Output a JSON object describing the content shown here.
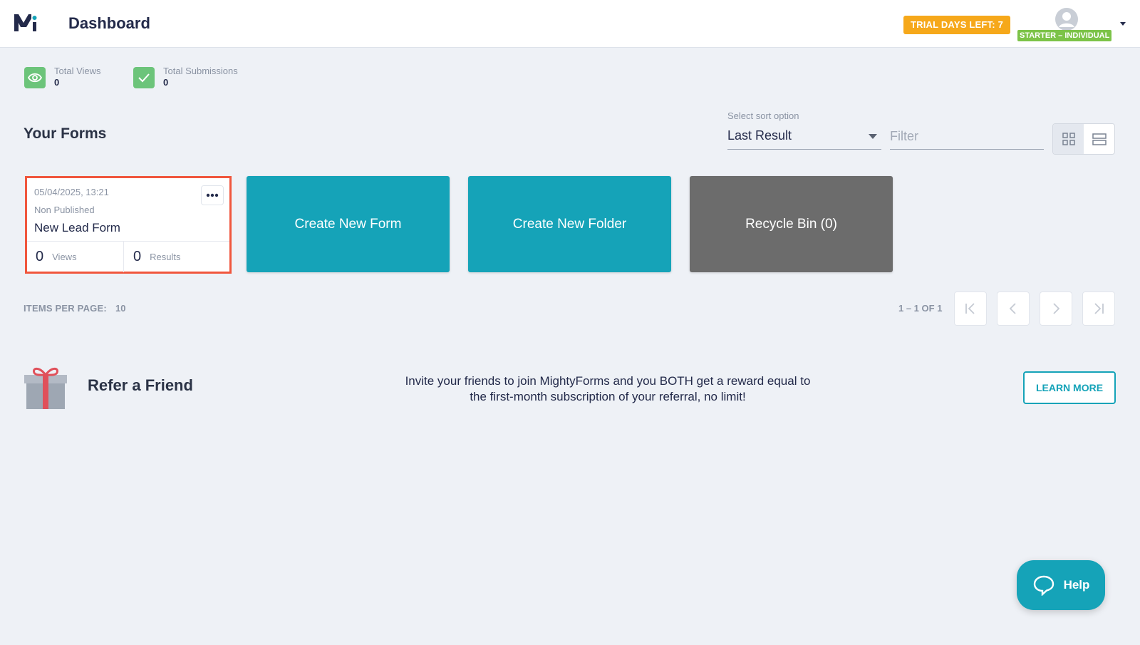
{
  "header": {
    "title": "Dashboard",
    "trial_badge": "TRIAL DAYS LEFT: 7",
    "plan_badge": "STARTER – INDIVIDUAL"
  },
  "stats": [
    {
      "label": "Total Views",
      "value": "0",
      "icon": "eye-icon"
    },
    {
      "label": "Total Submissions",
      "value": "0",
      "icon": "check-icon"
    }
  ],
  "forms_section": {
    "title": "Your Forms",
    "sort_label": "Select sort option",
    "sort_value": "Last Result",
    "filter_placeholder": "Filter"
  },
  "form_card": {
    "date": "05/04/2025, 13:21",
    "status": "Non Published",
    "name": "New Lead Form",
    "views_count": "0",
    "views_label": "Views",
    "results_count": "0",
    "results_label": "Results"
  },
  "actions": {
    "create_form": "Create New Form",
    "create_folder": "Create New Folder",
    "recycle_bin": "Recycle Bin (0)"
  },
  "pagination": {
    "items_per_page_label": "ITEMS PER PAGE:",
    "items_per_page_value": "10",
    "range": "1 – 1 OF 1"
  },
  "referral": {
    "title": "Refer a Friend",
    "text": "Invite your friends to join MightyForms and you BOTH get a reward equal to the first-month subscription of your referral, no limit!",
    "button": "LEARN MORE"
  },
  "help": {
    "label": "Help"
  },
  "colors": {
    "teal": "#15a3b8",
    "grey_card": "#6c6c6c",
    "trial_orange": "#f6a81a",
    "plan_green": "#7cc348",
    "highlight_red": "#f0563d",
    "stat_green": "#6cc47a"
  }
}
